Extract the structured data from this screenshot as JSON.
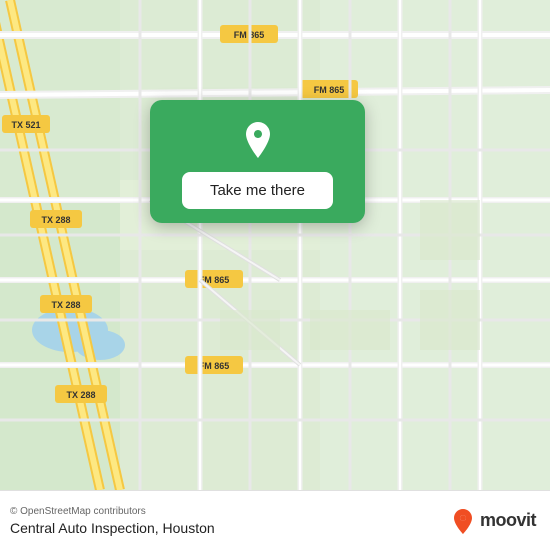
{
  "map": {
    "background_color": "#e8efdc",
    "card": {
      "button_label": "Take me there",
      "pin_color": "#ffffff"
    }
  },
  "bottom_bar": {
    "copyright": "© OpenStreetMap contributors",
    "location_name": "Central Auto Inspection, Houston",
    "moovit_label": "moovit"
  },
  "icons": {
    "location_pin": "📍",
    "moovit_pin": "🚌"
  }
}
